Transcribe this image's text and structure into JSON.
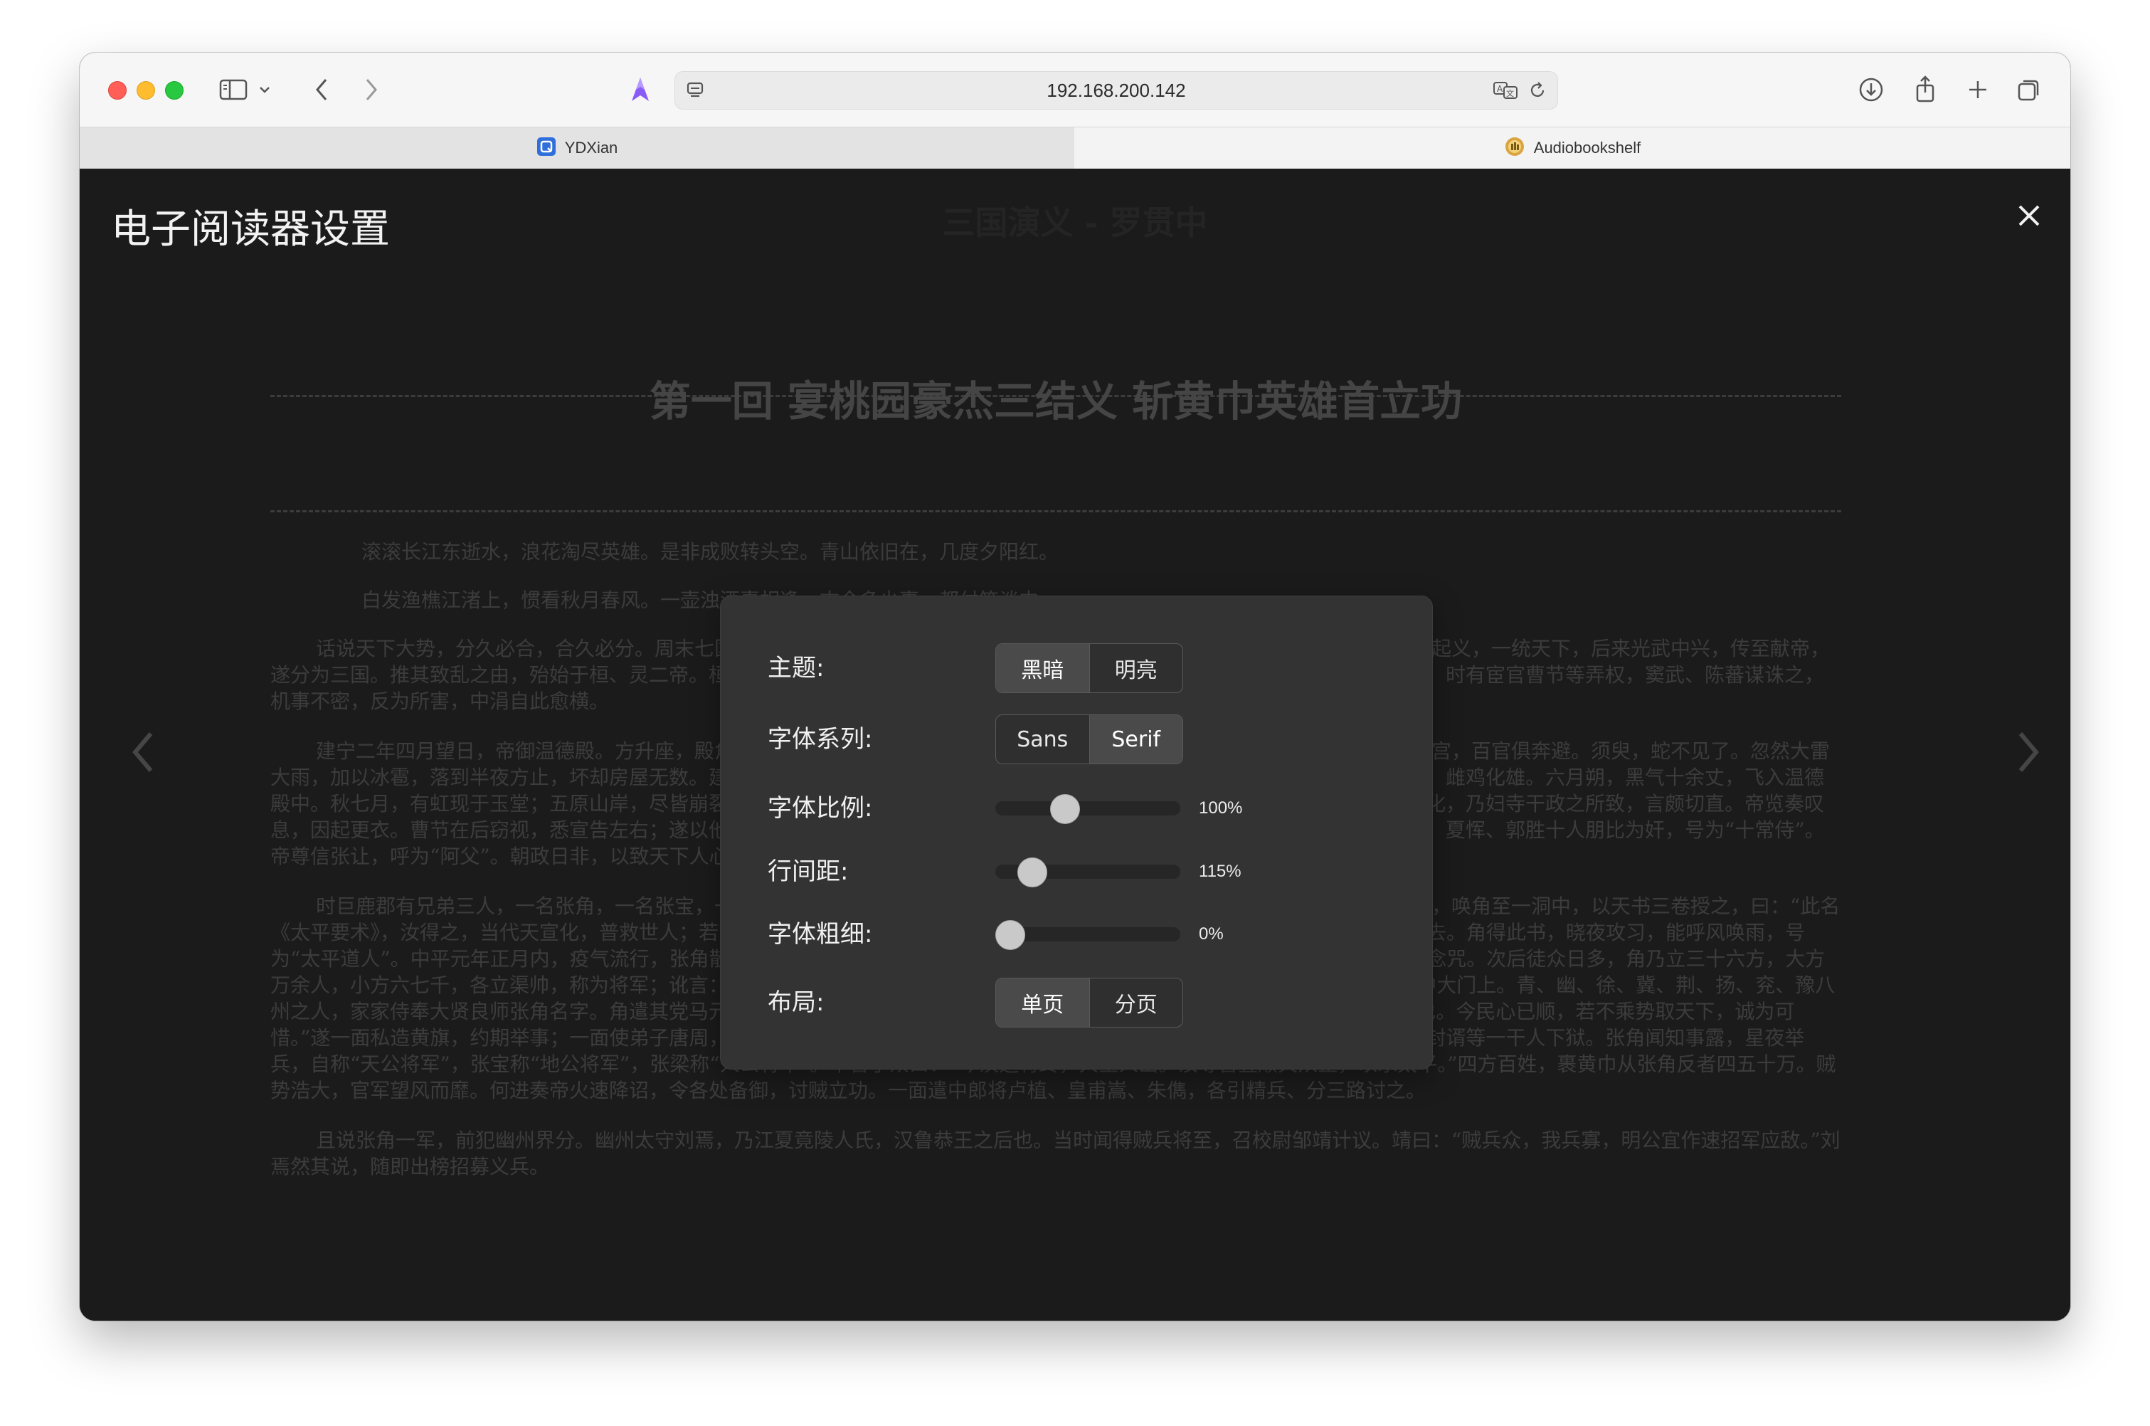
{
  "browser": {
    "url": "192.168.200.142",
    "tabs": [
      {
        "label": "YDXian"
      },
      {
        "label": "Audiobookshelf"
      }
    ]
  },
  "reader": {
    "book_title": "三国演义 - 罗贯中",
    "chapter_title": "第一回 宴桃园豪杰三结义 斩黄巾英雄首立功",
    "paragraphs": [
      "滚滚长江东逝水，浪花淘尽英雄。是非成败转头空。青山依旧在，几度夕阳红。",
      "白发渔樵江渚上，惯看秋月春风。一壶浊酒喜相逢。古今多少事，都付笑谈中。",
      "话说天下大势，分久必合，合久必分。周末七国分争，并入于秦。及秦灭之后，楚、汉分争，又并入于汉。汉朝自高祖斩白蛇而起义，一统天下，后来光武中兴，传至献帝，遂分为三国。推其致乱之由，殆始于桓、灵二帝。桓帝禁锢善类，崇信宦官。及桓帝崩，灵帝即位，大将军窦武、太傅陈蕃共相辅佐。时有宦官曹节等弄权，窦武、陈蕃谋诛之，机事不密，反为所害，中涓自此愈横。",
      "建宁二年四月望日，帝御温德殿。方升座，殿角狂风骤起。只见一条大青蛇，从梁上飞将下来，蟠于椅上。帝惊倒，左右急救入宫，百官俱奔避。须臾，蛇不见了。忽然大雷大雨，加以冰雹，落到半夜方止，坏却房屋无数。建宁四年二月，洛阳地震；又海水泛溢，沿海居民，尽被大浪卷入海中。光和元年，雌鸡化雄。六月朔，黑气十余丈，飞入温德殿中。秋七月，有虹现于玉堂；五原山岸，尽皆崩裂。种种不祥，非止一端。帝下诏问群臣以灾异之由，议郎蔡邕上疏，以为蜺堕鸡化，乃妇寺干政之所致，言颇切直。帝览奏叹息，因起更衣。曹节在后窃视，悉宣告左右；遂以他事陷邕于罪，放归田里。后张让、赵忠、封谞、段珪、曹节、侯览、蹇硕、程旷、夏恽、郭胜十人朋比为奸，号为“十常侍”。帝尊信张让，呼为“阿父”。朝政日非，以致天下人心思乱，盗贼蜂起。",
      "时巨鹿郡有兄弟三人，一名张角，一名张宝，一名张梁。那张角本是个不第秀才，因入山采药，遇一老人，碧眼童颜，手执藜杖，唤角至一洞中，以天书三卷授之，曰：“此名《太平要术》，汝得之，当代天宣化，普救世人；若萌异心，必获恶报。”角拜问姓名。老人曰：“吾乃南华老仙也。”言讫，化阵清风而去。角得此书，晓夜攻习，能呼风唤雨，号为“太平道人”。中平元年正月内，疫气流行，张角散施符水，为人治病，自称“大贤良师”。角有徒弟五百余人，云游四方，皆能书符念咒。次后徒众日多，角乃立三十六方，大方万余人，小方六七千，各立渠帅，称为将军；讹言：“苍天已死，黄天当立；岁在甲子，天下大吉。”令人各以白土书“甲子”二字于家中大门上。青、幽、徐、冀、荆、扬、兖、豫八州之人，家家侍奉大贤良师张角名字。角遣其党马元义，暗赍金帛，结交中涓封谞，以为内应。角与二弟商议曰：“至难得者，民心也。今民心已顺，若不乘势取天下，诚为可惜。”遂一面私造黄旗，约期举事；一面使弟子唐周，驰书报封谞。唐周乃径赴省中告变。帝召大将军何进调兵擒马元义，斩之；次收封谞等一干人下狱。张角闻知事露，星夜举兵，自称“天公将军”，张宝称“地公将军”，张梁称“人公将军”。申言于众曰：“今汉运将终，大圣人出。汝等皆宜顺天从正，以乐太平。”四方百姓，裹黄巾从张角反者四五十万。贼势浩大，官军望风而靡。何进奏帝火速降诏，令各处备御，讨贼立功。一面遣中郎将卢植、皇甫嵩、朱儁，各引精兵、分三路讨之。",
      "且说张角一军，前犯幽州界分。幽州太守刘焉，乃江夏竟陵人氏，汉鲁恭王之后也。当时闻得贼兵将至，召校尉邹靖计议。靖曰：“贼兵众，我兵寡，明公宜作速招军应敌。”刘焉然其说，随即出榜招募义兵。"
    ]
  },
  "settings": {
    "title": "电子阅读器设置",
    "theme": {
      "label": "主题:",
      "options": [
        "黑暗",
        "明亮"
      ],
      "selected": "黑暗"
    },
    "font_family": {
      "label": "字体系列:",
      "options": [
        "Sans",
        "Serif"
      ],
      "selected": "Serif"
    },
    "font_scale": {
      "label": "字体比例:",
      "value": "100%",
      "level": 0.35
    },
    "line_spacing": {
      "label": "行间距:",
      "value": "115%",
      "level": 0.14
    },
    "font_weight": {
      "label": "字体粗细:",
      "value": "0%",
      "level": 0.0
    },
    "layout": {
      "label": "布局:",
      "options": [
        "单页",
        "分页"
      ],
      "selected": "单页"
    }
  },
  "colors": {
    "tab_icon_ydxian": "#2f6fdc",
    "tab_icon_abs": "#d9a441",
    "extension_icon": "#8a5cf6"
  }
}
